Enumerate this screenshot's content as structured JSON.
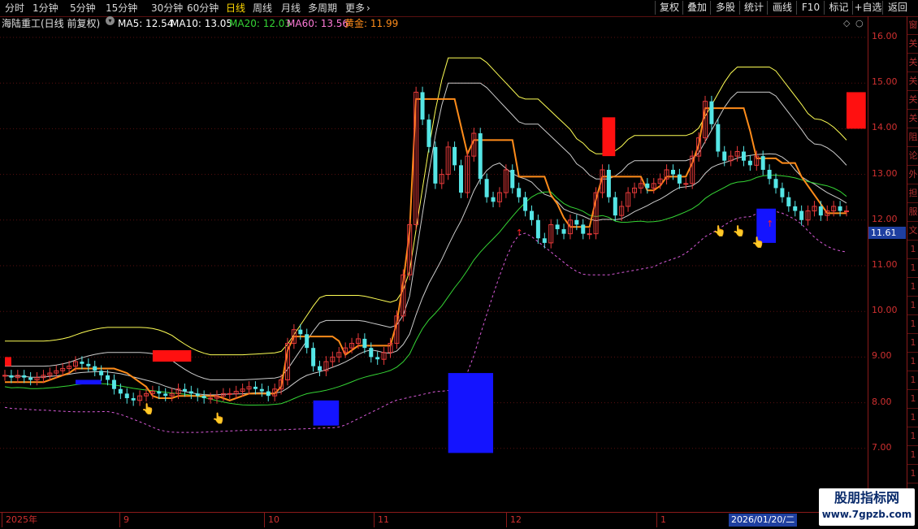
{
  "toolbar": {
    "periods": [
      "分时",
      "1分钟",
      "5分钟",
      "15分钟",
      "30分钟",
      "60分钟",
      "日线",
      "周线",
      "月线",
      "多周期",
      "更多"
    ],
    "more_arrow": "›",
    "active_period": "日线",
    "tools": [
      "复权",
      "叠加",
      "多股",
      "统计",
      "画线",
      "F10",
      "标记",
      "+自选",
      "返回"
    ]
  },
  "info": {
    "stock_name": "海陆重工(日线 前复权)",
    "ma5": "MA5: 12.54",
    "ma10": "MA10: 13.05",
    "ma20": "MA20: 12.03",
    "ma60": "MA60: 13.56",
    "gold": "黄金: 11.99",
    "dropdown_icon": "chevron-down-circle"
  },
  "price_axis": {
    "ticks": [
      "16.00",
      "15.00",
      "14.00",
      "13.00",
      "12.00",
      "11.00",
      "10.00",
      "9.00",
      "8.00",
      "7.00"
    ],
    "current_price": "11.61"
  },
  "date_axis": {
    "labels": [
      "2025年",
      "9",
      "10",
      "11",
      "12",
      "1"
    ],
    "cursor_date": "2026/01/20/二"
  },
  "right_strip": {
    "chars": [
      "窗",
      "关",
      "关",
      "关",
      "关",
      "关",
      "阻",
      "论",
      "外",
      "担",
      "服",
      "文",
      "1",
      "1",
      "1",
      "1",
      "1",
      "1",
      "1",
      "1",
      "1",
      "1",
      "1",
      "1",
      "1"
    ]
  },
  "watermark": {
    "title": "股朋指标网",
    "url": "www.7gpzb.com"
  },
  "colors": {
    "up": "#e83a3a",
    "down": "#55e6e6",
    "ma5": "#ffffff",
    "ma10": "#ffff55",
    "ma20": "#35d535",
    "ma60": "#d85ad8",
    "gold": "#ff8c1a",
    "blue_block": "#1414ff",
    "red_block": "#ff1010",
    "axis": "#8b1a1a"
  },
  "chart_data": {
    "type": "candlestick",
    "title": "海陆重工(日线 前复权)",
    "ylim": [
      6.5,
      16.6
    ],
    "x_labels": [
      "2025年",
      "9",
      "10",
      "11",
      "12",
      "1"
    ],
    "series": [
      {
        "name": "MA5",
        "last": 12.54
      },
      {
        "name": "MA10",
        "last": 13.05
      },
      {
        "name": "MA20",
        "last": 12.03
      },
      {
        "name": "MA60",
        "last": 13.56
      },
      {
        "name": "黄金",
        "last": 11.99
      }
    ],
    "current_price": 11.61,
    "approx_closes": [
      8.6,
      8.55,
      8.6,
      8.55,
      8.5,
      8.55,
      8.6,
      8.65,
      8.7,
      8.75,
      8.8,
      8.9,
      8.85,
      8.8,
      8.7,
      8.6,
      8.5,
      8.3,
      8.2,
      8.1,
      8.05,
      8.15,
      8.2,
      8.25,
      8.2,
      8.15,
      8.2,
      8.3,
      8.25,
      8.2,
      8.15,
      8.1,
      8.1,
      8.15,
      8.2,
      8.2,
      8.25,
      8.3,
      8.35,
      8.3,
      8.25,
      8.15,
      8.3,
      8.5,
      9.3,
      9.6,
      9.5,
      9.2,
      8.8,
      8.7,
      8.9,
      9.0,
      9.1,
      9.2,
      9.3,
      9.4,
      9.2,
      9.0,
      8.95,
      9.1,
      9.3,
      9.9,
      10.8,
      11.9,
      14.8,
      14.2,
      13.6,
      12.8,
      13.0,
      13.6,
      13.2,
      12.6,
      13.4,
      13.9,
      12.9,
      12.5,
      12.4,
      12.6,
      13.1,
      12.7,
      12.5,
      12.2,
      12.0,
      11.6,
      11.5,
      11.9,
      11.8,
      11.7,
      12.0,
      11.9,
      11.7,
      11.7,
      12.6,
      13.1,
      12.5,
      12.1,
      12.3,
      12.6,
      12.7,
      12.8,
      12.7,
      12.8,
      12.9,
      13.1,
      13.0,
      12.8,
      12.8,
      13.4,
      13.8,
      14.6,
      14.1,
      13.5,
      13.3,
      13.4,
      13.5,
      13.3,
      13.2,
      13.4,
      13.1,
      12.9,
      12.7,
      12.5,
      12.3,
      12.2,
      12.0,
      12.2,
      12.3,
      12.1,
      12.2,
      12.3,
      12.2,
      12.2
    ]
  }
}
